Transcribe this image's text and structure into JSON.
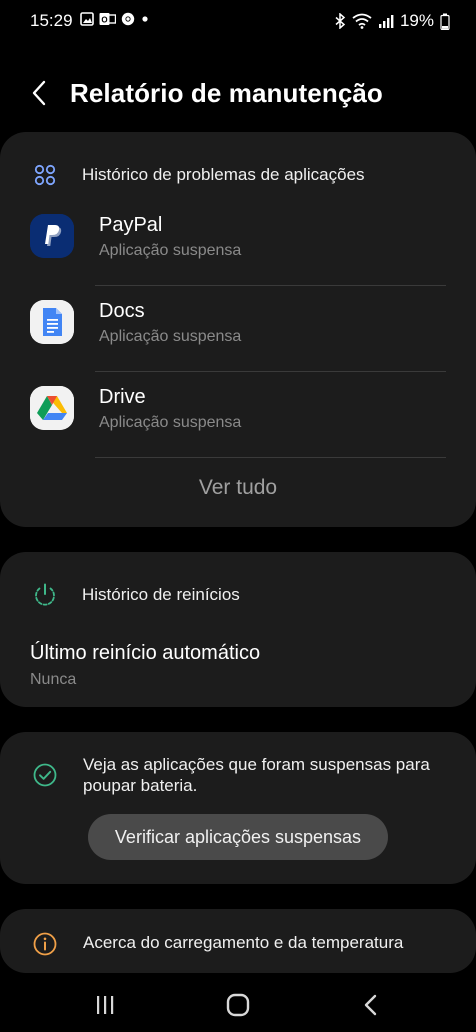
{
  "status_bar": {
    "time": "15:29",
    "battery_text": "19%",
    "left_icons": [
      "image-icon",
      "outlook-icon",
      "chrome-icon",
      "dot-icon"
    ],
    "right_icons": [
      "bluetooth-icon",
      "wifi-icon",
      "signal-icon",
      "battery-icon"
    ]
  },
  "header": {
    "title": "Relatório de manutenção"
  },
  "app_problems": {
    "section_title": "Histórico de problemas de aplicações",
    "apps": [
      {
        "name": "PayPal",
        "status": "Aplicação suspensa",
        "icon": "paypal-icon"
      },
      {
        "name": "Docs",
        "status": "Aplicação suspensa",
        "icon": "docs-icon"
      },
      {
        "name": "Drive",
        "status": "Aplicação suspensa",
        "icon": "drive-icon"
      }
    ],
    "see_all": "Ver tudo"
  },
  "restarts": {
    "section_title": "Histórico de reinícios",
    "item_title": "Último reinício automático",
    "item_value": "Nunca"
  },
  "suspended_info": {
    "text": "Veja as aplicações que foram suspensas para poupar bateria.",
    "button": "Verificar aplicações suspensas"
  },
  "charging": {
    "text": "Acerca do carregamento e da temperatura"
  },
  "colors": {
    "background": "#000000",
    "card": "#1c1c1c",
    "button": "#4a4a4a",
    "accent_blue": "#7fa6ff",
    "accent_green": "#3fb88a",
    "accent_orange": "#f0a048"
  }
}
